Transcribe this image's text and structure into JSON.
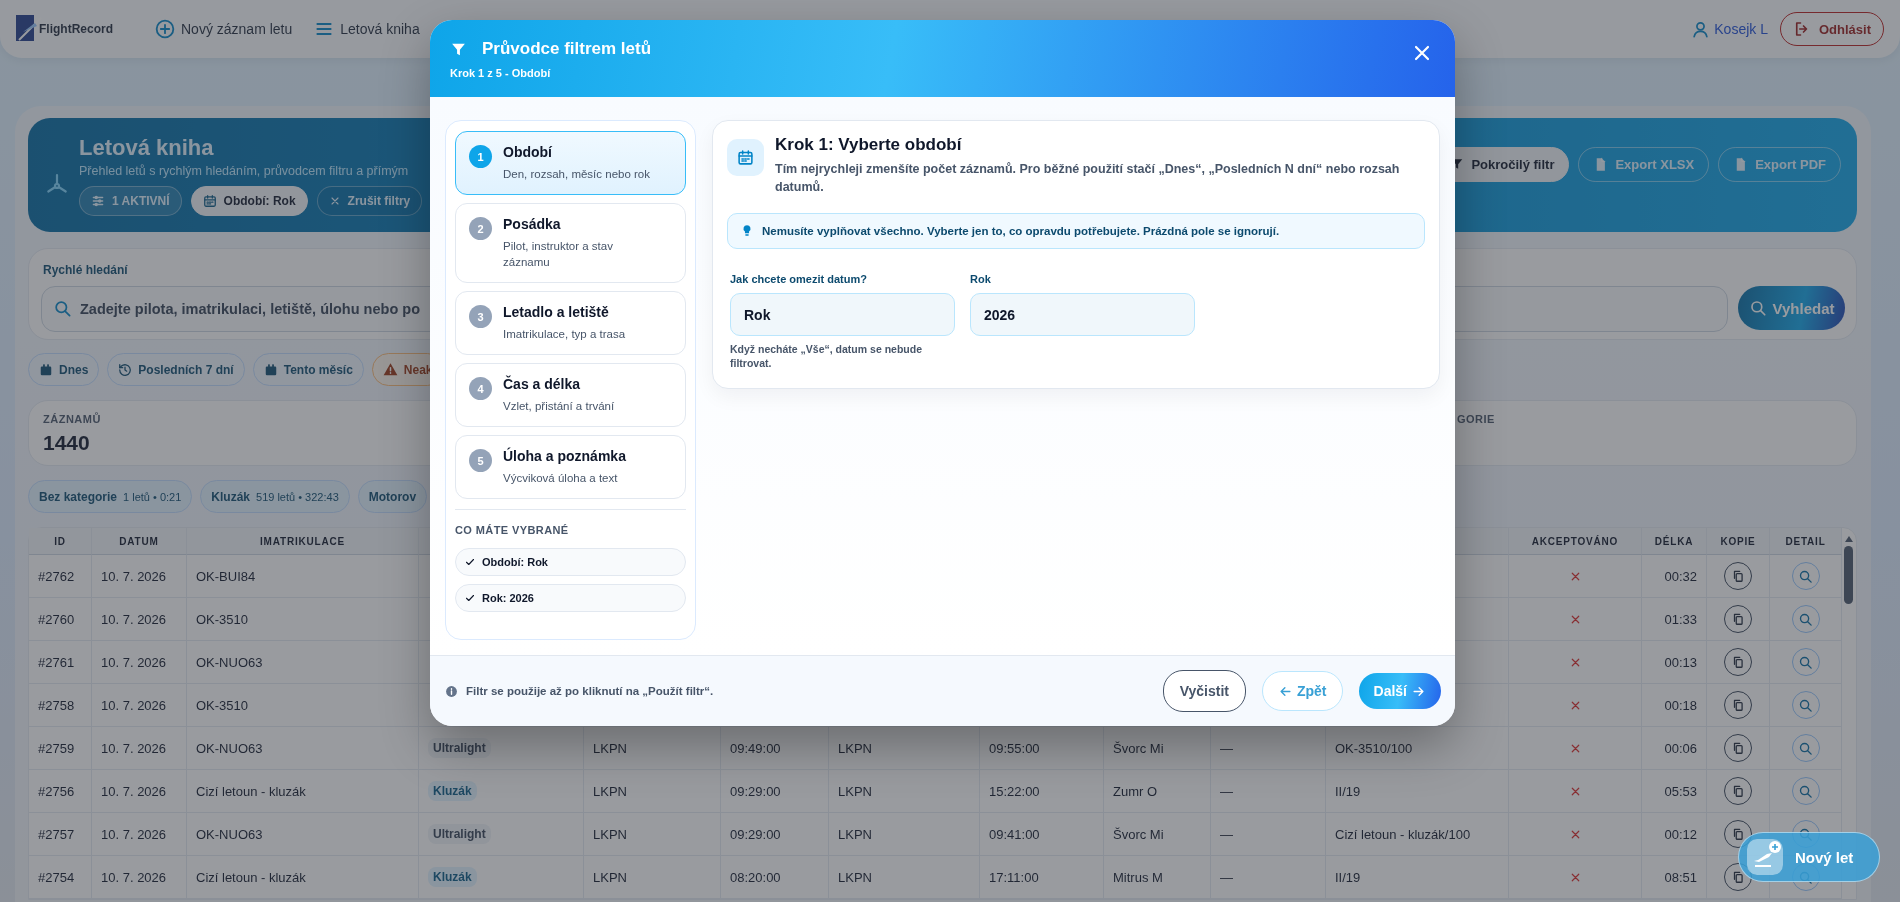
{
  "nav": {
    "logo": "FlightRecord",
    "links": [
      {
        "label": "Nový záznam letu",
        "kind": "add"
      },
      {
        "label": "Letová kniha",
        "kind": "list"
      }
    ],
    "user": "Kosejk L",
    "logout": "Odhlásit"
  },
  "hero": {
    "title": "Letová kniha",
    "subtitle": "Přehled letů s rychlým hledáním, průvodcem filtru a přímým",
    "chips": [
      {
        "label": "1 AKTIVNÍ",
        "kind": "count"
      },
      {
        "label": "Období: Rok",
        "kind": "filter"
      },
      {
        "label": "Zrušit filtry",
        "kind": "clear"
      }
    ],
    "actions": [
      {
        "label": "Pokročilý filtr",
        "kind": "filter"
      },
      {
        "label": "Export XLSX",
        "kind": "xlsx"
      },
      {
        "label": "Export PDF",
        "kind": "pdf"
      }
    ]
  },
  "search": {
    "label": "Rychlé hledání",
    "placeholder": "Zadejte pilota, imatrikulaci, letiště, úlohu nebo po",
    "button": "Vyhledat"
  },
  "quick_filters": [
    {
      "label": "Dnes",
      "kind": "today"
    },
    {
      "label": "Posledních 7 dní",
      "kind": "history"
    },
    {
      "label": "Tento měsíc",
      "kind": "month"
    },
    {
      "label": "Neak",
      "kind": "warning"
    }
  ],
  "stats": [
    {
      "label": "ZÁZNAMŮ",
      "value": "1440"
    },
    {
      "label": "GORIE"
    }
  ],
  "categories": [
    {
      "name": "Bez kategorie",
      "detail": "1 letů • 0:21"
    },
    {
      "name": "Kluzák",
      "detail": "519 letů • 322:43"
    },
    {
      "name": "Motorov"
    }
  ],
  "table": {
    "columns_left": [
      "ID",
      "DATUM",
      "IMATRIKULACE"
    ],
    "columns_right": [
      "AKCEPTOVÁNO",
      "DÉLKA",
      "KOPIE",
      "DETAIL"
    ],
    "rows": [
      {
        "id": "#2762",
        "date": "10. 7. 2026",
        "registration": "OK-BUI84",
        "accepted": false,
        "duration": "00:32"
      },
      {
        "id": "#2760",
        "date": "10. 7. 2026",
        "registration": "OK-3510",
        "accepted": false,
        "duration": "01:33"
      },
      {
        "id": "#2761",
        "date": "10. 7. 2026",
        "registration": "OK-NUO63",
        "accepted": false,
        "duration": "00:13"
      },
      {
        "id": "#2758",
        "date": "10. 7. 2026",
        "registration": "OK-3510",
        "accepted": false,
        "duration": "00:18"
      },
      {
        "id": "#2759",
        "date": "10. 7. 2026",
        "registration": "OK-NUO63",
        "column_4": {
          "label": "Ultralight",
          "kind": "neutral"
        },
        "column_5": "LKPN",
        "column_6": "09:49:00",
        "column_7": "LKPN",
        "column_8": "09:55:00",
        "column_9": "Švorc Mi",
        "column_10": "—",
        "column_11": "OK-3510/100",
        "accepted": false,
        "duration": "00:06"
      },
      {
        "id": "#2756",
        "date": "10. 7. 2026",
        "registration": "Cizí letoun - kluzák",
        "column_4": {
          "label": "Kluzák",
          "kind": "accent"
        },
        "column_5": "LKPN",
        "column_6": "09:29:00",
        "column_7": "LKPN",
        "column_8": "15:22:00",
        "column_9": "Zumr O",
        "column_10": "—",
        "column_11": "II/19",
        "accepted": false,
        "duration": "05:53"
      },
      {
        "id": "#2757",
        "date": "10. 7. 2026",
        "registration": "OK-NUO63",
        "column_4": {
          "label": "Ultralight",
          "kind": "neutral"
        },
        "column_5": "LKPN",
        "column_6": "09:29:00",
        "column_7": "LKPN",
        "column_8": "09:41:00",
        "column_9": "Švorc Mi",
        "column_10": "—",
        "column_11": "Cizí letoun - kluzák/100",
        "accepted": false,
        "duration": "00:12"
      },
      {
        "id": "#2754",
        "date": "10. 7. 2026",
        "registration": "Cizí letoun - kluzák",
        "column_4": {
          "label": "Kluzák",
          "kind": "accent"
        },
        "column_5": "LKPN",
        "column_6": "08:20:00",
        "column_7": "LKPN",
        "column_8": "17:11:00",
        "column_9": "Mitrus M",
        "column_10": "—",
        "column_11": "II/19",
        "accepted": false,
        "duration": "08:51"
      }
    ]
  },
  "fab": {
    "label": "Nový let"
  },
  "wizard": {
    "title": "Průvodce filtrem letů",
    "subtitle": "Krok 1 z 5 - Období",
    "steps": [
      {
        "number": "1",
        "title": "Období",
        "description": "Den, rozsah, měsíc nebo rok",
        "selected": true
      },
      {
        "number": "2",
        "title": "Posádka",
        "description": "Pilot, instruktor a stav záznamu",
        "selected": false
      },
      {
        "number": "3",
        "title": "Letadlo a letiště",
        "description": "Imatrikulace, typ a trasa",
        "selected": false
      },
      {
        "number": "4",
        "title": "Čas a délka",
        "description": "Vzlet, přistání a trvání",
        "selected": false
      },
      {
        "number": "5",
        "title": "Úloha a poznámka",
        "description": "Výcviková úloha a text",
        "selected": false
      }
    ],
    "summary_title": "CO MÁTE VYBRANÉ",
    "summary": [
      "Období: Rok",
      "Rok: 2026"
    ],
    "step_title": "Krok 1: Vyberte období",
    "step_description": "Tím nejrychleji zmenšíte počet záznamů. Pro běžné použití stačí „Dnes“, „Posledních N dní“ nebo rozsah datumů.",
    "tip": "Nemusíte vyplňovat všechno. Vyberte jen to, co opravdu potřebujete. Prázdná pole se ignorují.",
    "fields": [
      {
        "label": "Jak chcete omezit datum?",
        "value": "Rok",
        "hint": "Když necháte „Vše“, datum se nebude filtrovat."
      },
      {
        "label": "Rok",
        "value": "2026"
      }
    ],
    "footer_note": "Filtr se použije až po kliknutí na „Použít filtr“.",
    "buttons": [
      {
        "label": "Vyčistit",
        "kind": "clear"
      },
      {
        "label": "Zpět",
        "kind": "back"
      },
      {
        "label": "Další",
        "kind": "next"
      }
    ]
  }
}
